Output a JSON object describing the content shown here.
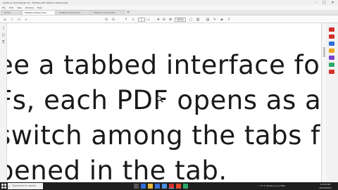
{
  "window": {
    "title": "Adobe Acrobat Reader DC - Multiple PDF tabbed interface.pdf",
    "controls": {
      "minimize": "–",
      "maximize": "□",
      "close": "✕"
    }
  },
  "menu": [
    "File",
    "Edit",
    "View",
    "Window",
    "Help"
  ],
  "tabs": [
    {
      "label": "Home"
    },
    {
      "label": "Multiple tabbed inte...",
      "active": true
    },
    {
      "label": "Multiple documents..."
    },
    {
      "label": "Multiple documents..."
    }
  ],
  "toolbar": {
    "page_current": "1",
    "page_total": "/ 1",
    "zoom": "260%"
  },
  "document": {
    "lines": [
      "ee a tabbed interface for",
      "Fs, each PDF opens as a",
      "switch among the tabs fr",
      "pened in the tab."
    ]
  },
  "taskbar": {
    "search_placeholder": "Type here to search",
    "tray_text": "^ 27°C  Mostly sunny  ENG",
    "time": "10:32 AM",
    "date": "2021/03/16"
  },
  "colors": {
    "taskbar": "#1f1f1f",
    "text": "#1a1a1a",
    "accent_red": "#d4302b",
    "accent_blue": "#2b6fd6"
  }
}
